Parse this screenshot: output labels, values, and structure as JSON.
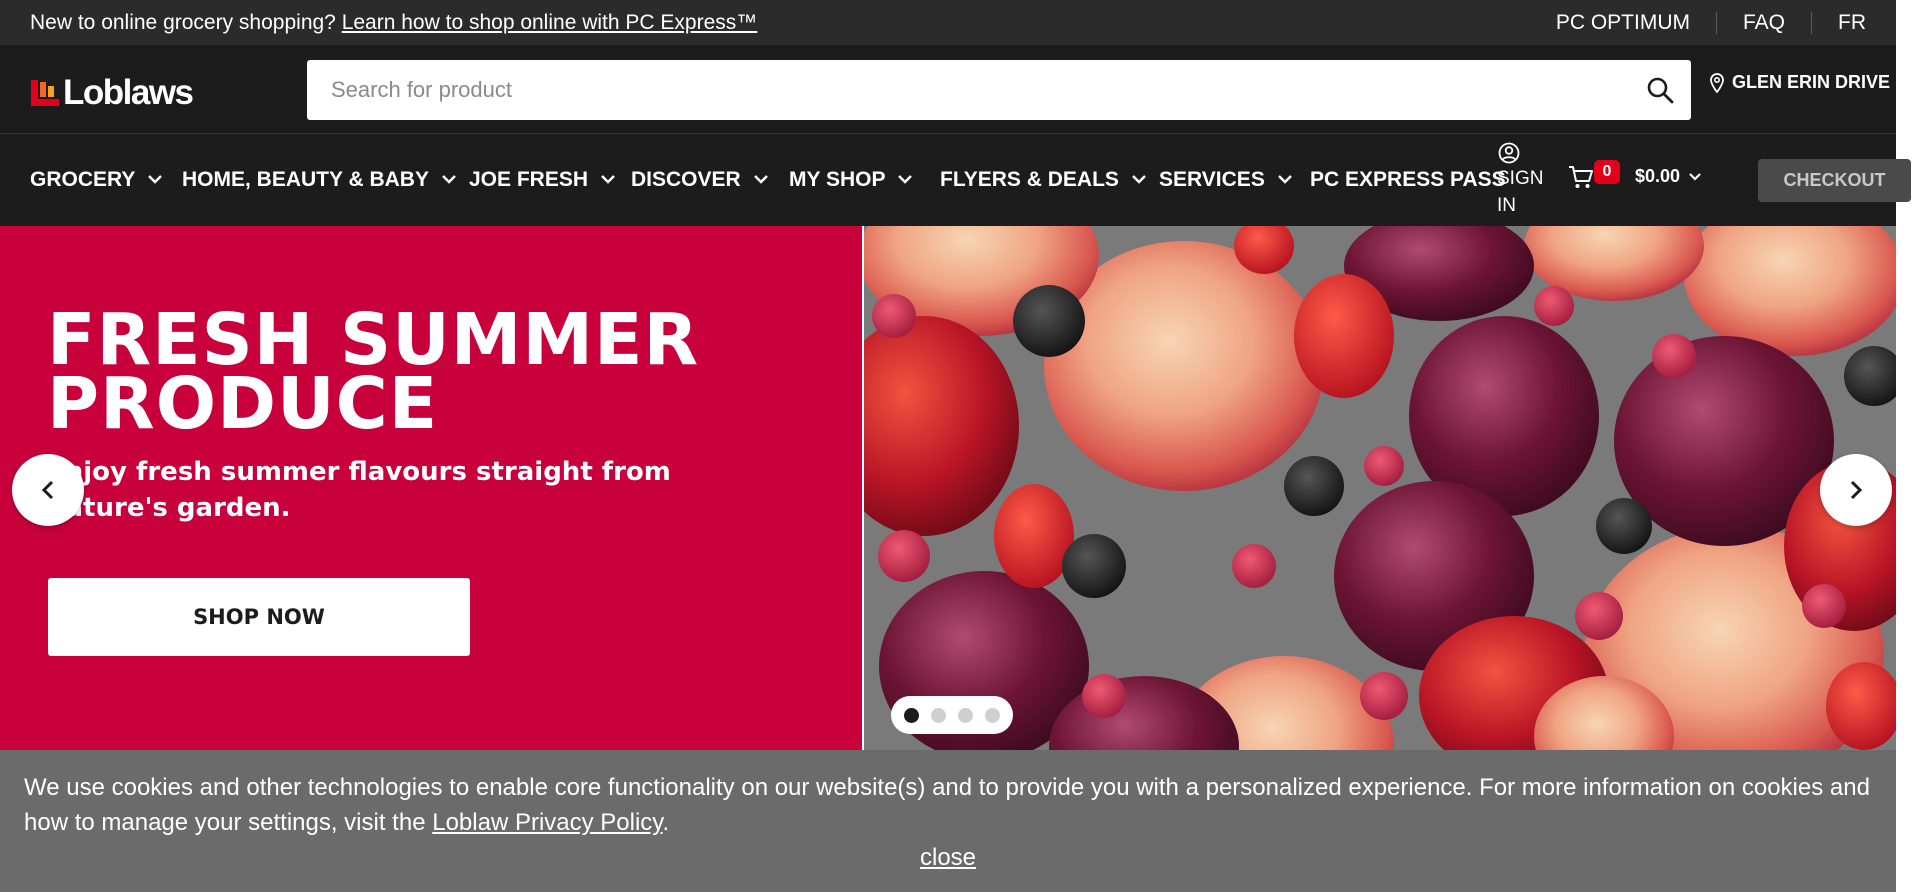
{
  "utility_bar": {
    "promo_text": "New to online grocery shopping?",
    "promo_link": "Learn how to shop online with PC Express™",
    "links": [
      "PC OPTIMUM",
      "FAQ",
      "FR"
    ]
  },
  "header": {
    "logo_text": "Loblaws",
    "search_placeholder": "Search for product",
    "store_name": "GLEN ERIN DRIVE"
  },
  "nav": {
    "items": [
      {
        "label": "GROCERY",
        "has_dropdown": true
      },
      {
        "label": "HOME, BEAUTY & BABY",
        "has_dropdown": true
      },
      {
        "label": "JOE FRESH",
        "has_dropdown": true
      },
      {
        "label": "DISCOVER",
        "has_dropdown": true
      },
      {
        "label": "MY SHOP",
        "has_dropdown": true
      },
      {
        "label": "FLYERS & DEALS",
        "has_dropdown": true
      },
      {
        "label": "SERVICES",
        "has_dropdown": true
      },
      {
        "label": "PC EXPRESS PASS",
        "has_dropdown": false
      }
    ],
    "sign_in_line1": "SIGN",
    "sign_in_line2": "IN",
    "cart_count": "0",
    "cart_total": "$0.00",
    "checkout_label": "CHECKOUT"
  },
  "hero": {
    "title": "FRESH SUMMER PRODUCE",
    "subtitle": "Enjoy fresh summer flavours straight from nature's garden.",
    "cta_label": "SHOP NOW",
    "background_color": "#c8003c",
    "slide_count": 4,
    "active_slide": 1
  },
  "cookie_banner": {
    "text_before_link": "We use cookies and other technologies to enable core functionality on our website(s) and to provide you with a personalized experience. For more information on cookies and how to manage your settings, visit the",
    "policy_link": "Loblaw Privacy Policy",
    "text_after_link": ".",
    "close_label": "close"
  },
  "colors": {
    "utility_bar_bg": "#2b2b2b",
    "header_bg": "#1c1c1c",
    "brand_red": "#e3001b",
    "hero_bg": "#c8003c",
    "cookie_bg": "#6b6b6b"
  },
  "icons": [
    "search-icon",
    "location-pin-icon",
    "user-icon",
    "cart-icon",
    "chevron-down-icon",
    "chevron-left-icon",
    "chevron-right-icon"
  ]
}
